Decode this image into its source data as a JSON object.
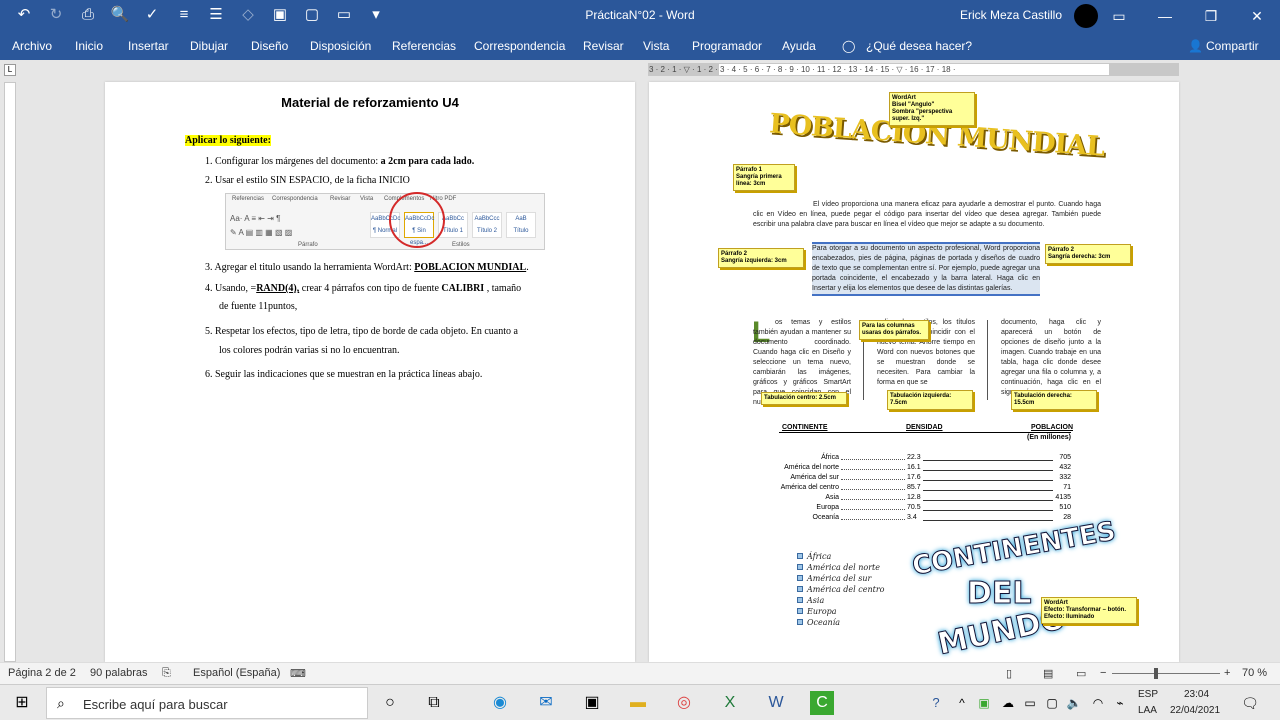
{
  "window": {
    "title": "PrácticaN°02 - Word",
    "user": "Erick Meza Castillo"
  },
  "menu": {
    "items": [
      "Archivo",
      "Inicio",
      "Insertar",
      "Dibujar",
      "Diseño",
      "Disposición",
      "Referencias",
      "Correspondencia",
      "Revisar",
      "Vista",
      "Programador",
      "Ayuda"
    ],
    "help": "¿Qué desea hacer?",
    "share": "Compartir"
  },
  "ruler": "3 · 2 · 1 · ▽ · 1 · 2 · 3 · 4 · 5 · 6 · 7 · 8 · 9 · 10 · 11 · 12 · 13 · 14 · 15 · ▽ · 16 · 17 · 18 ·",
  "page1": {
    "heading": "Material de reforzamiento U4",
    "apply": "Aplicar lo siguiente:",
    "l1": "1.    Configurar los márgenes del documento: ",
    "l1b": "a 2cm para cada lado.",
    "l2": "2.    Usar el estilo SIN ESPACIO, de la ficha INICIO",
    "l3": "3.    Agregar el titulo usando la herramienta WordArt: ",
    "l3b": "POBLACION   MUNDIAL",
    "l3c": ".",
    "l4": "4.    Usando, =",
    "l4b": "RAND(4),",
    "l4c": " crear 4 párrafos con tipo de fuente ",
    "l4d": "CALIBRI",
    "l4e": "    , tamaño",
    "l4f": "de fuente 11puntos,",
    "l5": "5.    Respetar los efectos, tipo de letra, tipo de borde de cada objeto. En cuanto a",
    "l5b": "los colores podrán varias si no lo encuentran.",
    "l6": "6.    Seguir las indicaciones que se muestran en la práctica líneas abajo.",
    "ribbon_tabs": [
      "Referencias",
      "Correspondencia",
      "Revisar",
      "Vista",
      "Complementos",
      "Nitro PDF"
    ],
    "ribbon_styles": [
      "AaBbCcDc",
      "AaBbCcDc",
      "AaBbCc",
      "AaBbCcc",
      "AaB"
    ],
    "ribbon_style_names": [
      "¶ Normal",
      "¶ Sin espa...",
      "Título 1",
      "Título 2",
      "Título"
    ],
    "ribbon_groups": [
      "Párrafo",
      "Estilos"
    ]
  },
  "page2": {
    "wordart": "POBLACION MUNDIAL",
    "c_wordart": "WordArt\nBisel \"Angulo\"\nSombra        \"perspectiva\nsuper. Izq.\"",
    "c_parrafo1": "Párrafo 1\nSangría primera\nlínea: 3cm",
    "c_parrafo2l": "Párrafo 2\nSangría izquierda: 3cm",
    "c_parrafo2r": "Párrafo 2\nSangría derecha: 3cm",
    "c_columnas": "Para las columnas\nusaras dos párrafos.",
    "c_tab1": "Tabulación centro: 2.5cm",
    "c_tab2": "Tabulación   izquierda:\n7.5cm",
    "c_tab3": "Tabulación   derecha:\n15.5cm",
    "c_wordart2": "WordArt\nEfecto: Transformar – botón.\nEfecto: Iluminado",
    "para1": "El vídeo proporciona una manera eficaz para ayudarle a demostrar el punto. Cuando haga clic en Vídeo en línea, puede pegar el código para insertar del vídeo que desea agregar. También puede escribir una palabra clave para buscar en línea el vídeo que mejor se adapte a su documento.",
    "para2": "Para otorgar a su documento un aspecto profesional, Word proporciona encabezados, pies de página, páginas de portada y diseños de cuadro de texto que se complementan entre sí. Por ejemplo, puede agregar una portada coincidente, el encabezado y la barra lateral. Haga clic en Insertar y elija los elementos que desee de las distintas galerías.",
    "col1": "os temas y estilos también ayudan a mantener su documento coordinado. Cuando haga clic en Diseño y seleccione un tema nuevo, cambiarán las imágenes, gráficos y gráficos SmartArt para que coincidan con el nuevo tema.",
    "col2": "aplicar los estilos, los títulos cambian para coincidir con el nuevo tema. Ahorre tiempo en Word con nuevos botones que se muestran donde se necesiten. Para cambiar la forma en que se",
    "col3": "documento, haga clic y aparecerá un botón de opciones de diseño junto a la imagen. Cuando trabaje en una tabla, haga clic donde desee agregar una fila o columna y, a continuación, haga clic en el signo más.",
    "th_cont": "CONTINENTE",
    "th_dens": "DENSIDAD",
    "th_pob": "POBLACION",
    "th_unit": "(En millones)",
    "rows": [
      {
        "c": "África",
        "d": "22.3",
        "p": "705"
      },
      {
        "c": "América del norte",
        "d": "16.1",
        "p": "432"
      },
      {
        "c": "América del sur",
        "d": "17.6",
        "p": "332"
      },
      {
        "c": "América del centro",
        "d": "85.7",
        "p": "71"
      },
      {
        "c": "Asia",
        "d": "12.8",
        "p": "4135"
      },
      {
        "c": "Europa",
        "d": "70.5",
        "p": "510"
      },
      {
        "c": "Oceanía",
        "d": "3.4",
        "p": "28"
      }
    ],
    "list": [
      "África",
      "América del norte",
      "América del sur",
      "América del centro",
      "Asia",
      "Europa",
      "Oceanía"
    ],
    "circle_top": "CONTINENTES",
    "circle_mid": "DEL",
    "circle_bot": "MUNDO"
  },
  "status": {
    "page": "Página 2 de 2",
    "words": "90 palabras",
    "lang": "Español (España)",
    "zoom": "70 %"
  },
  "taskbar": {
    "search_placeholder": "Escribe aquí para buscar",
    "lang1": "ESP",
    "lang2": "LAA",
    "time": "23:04",
    "date": "22/04/2021"
  }
}
